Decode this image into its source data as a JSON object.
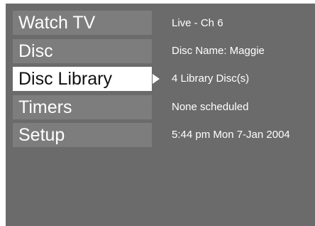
{
  "menu": {
    "items": [
      {
        "label": "Watch TV",
        "selected": false
      },
      {
        "label": "Disc",
        "selected": false
      },
      {
        "label": "Disc Library",
        "selected": true
      },
      {
        "label": "Timers",
        "selected": false
      },
      {
        "label": "Setup",
        "selected": false
      }
    ]
  },
  "info": {
    "watch_tv": "Live - Ch 6",
    "disc": "Disc Name: Maggie",
    "disc_library": "4 Library Disc(s)",
    "timers": "None scheduled",
    "setup": "5:44 pm Mon 7-Jan 2004"
  },
  "colors": {
    "background": "#6b6b6b",
    "menu_item_bg": "#7d7d7d",
    "selected_bg": "#ffffff",
    "text": "#ffffff"
  },
  "icons": {
    "selection_indicator": "triangle-right-icon"
  }
}
